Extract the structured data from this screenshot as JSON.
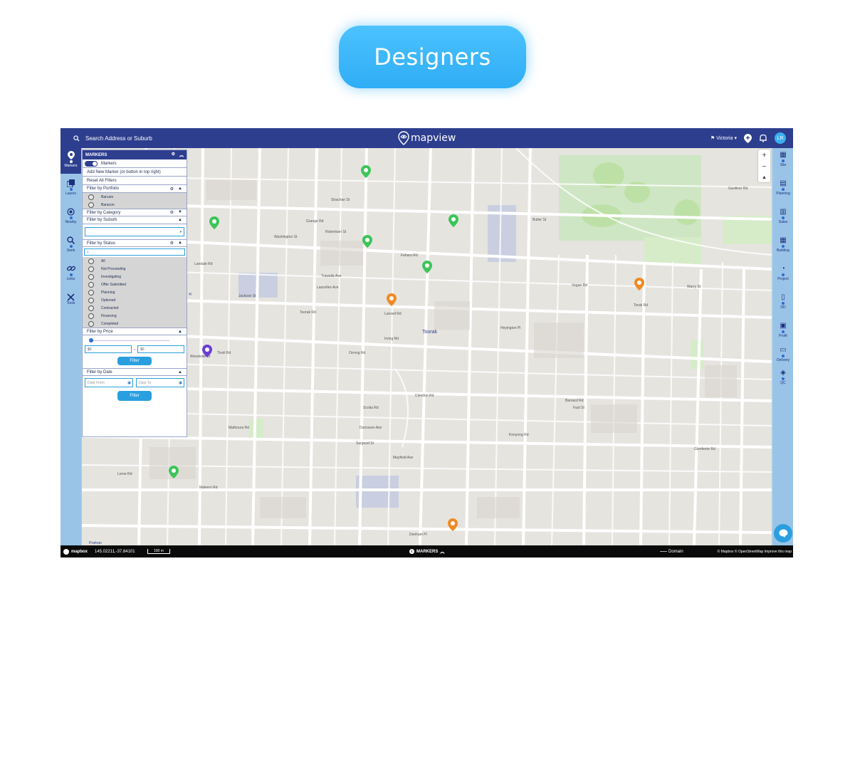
{
  "banner": {
    "label": "Designers"
  },
  "topbar": {
    "search_placeholder": "Search Address or Suburb",
    "logo": "mapview",
    "region": "Victoria",
    "avatar": "LR"
  },
  "left_rail": [
    {
      "label": "Markers",
      "icon": "map-pin-icon"
    },
    {
      "label": "Layers",
      "icon": "layers-icon"
    },
    {
      "label": "Nearby",
      "icon": "target-icon"
    },
    {
      "label": "Seek",
      "icon": "search-icon"
    },
    {
      "label": "Links",
      "icon": "link-icon"
    },
    {
      "label": "Tools",
      "icon": "tools-icon"
    }
  ],
  "right_rail": [
    {
      "label": "Site",
      "icon": "site-icon"
    },
    {
      "label": "Planning",
      "icon": "calendar-icon"
    },
    {
      "label": "Sales",
      "icon": "chart-icon"
    },
    {
      "label": "Building",
      "icon": "building-icon"
    },
    {
      "label": "Project",
      "icon": "project-icon"
    },
    {
      "label": "DD",
      "icon": "document-icon"
    },
    {
      "label": "Profit",
      "icon": "profit-icon"
    },
    {
      "label": "Delivery",
      "icon": "delivery-icon"
    },
    {
      "label": "QC",
      "icon": "qc-icon"
    }
  ],
  "panel": {
    "title": "MARKERS",
    "markers_toggle": "Markers",
    "add_new": "Add New Marker (or button in top right)",
    "reset": "Reset All Filters",
    "portfolio": {
      "label": "Filter by Portfolio",
      "options": [
        "Barcam",
        "Baracon"
      ]
    },
    "category": {
      "label": "Filter by Category"
    },
    "suburb": {
      "label": "Filter by Suburb"
    },
    "status": {
      "label": "Filter by Status",
      "options": [
        "All",
        "Not Proceeding",
        "Investigating",
        "Offer Submitted",
        "Planning",
        "Optioned",
        "Contracted",
        "Financing",
        "Completed"
      ]
    },
    "price": {
      "label": "Filter by Price",
      "min": "$0",
      "max": "$0",
      "separator": "-",
      "button": "Filter"
    },
    "date": {
      "label": "Filter by Date",
      "from_placeholder": "Date From",
      "to_placeholder": "Date To",
      "button": "Filter"
    }
  },
  "map": {
    "streets": [
      "Strachan St",
      "Washington St",
      "Robertson St",
      "Landale Rd",
      "Jackson St",
      "Toorak Rd",
      "Lascelles Ave",
      "Tivoli Rd",
      "Grange Rd",
      "Orrong Rd",
      "Woodside Cr",
      "Malvern Rd",
      "Mathoura Rd",
      "Irving Rd",
      "Kooyong Rd",
      "Toorak",
      "Glenferrie Rd",
      "Warry St",
      "Butler St",
      "Fahara Rd",
      "Clendon Rd",
      "Lansell Rd",
      "Heyington Pl",
      "Trawalla Ave",
      "Scotia Rd",
      "Sargood St",
      "Dunraven Ave",
      "Mayfield Ave",
      "Denham Pl",
      "Lorne Rd",
      "Prahran",
      "Gardiner Rd",
      "Vogue Rd",
      "Fast St",
      "Torak Rd",
      "Barnard Rd"
    ]
  },
  "bottombar": {
    "brand": "mapbox",
    "coords": "145.02211,-37.84101",
    "scale": "100 m",
    "markers_label": "MARKERS",
    "domain": "Domain",
    "attribution": "© Mapbox © OpenStreetMap Improve this map"
  },
  "colors": {
    "nav": "#2d3e8f",
    "accent": "#2a9fe0",
    "green_pin": "#3dc45a",
    "orange_pin": "#f08a24",
    "purple_pin": "#6b3fd0"
  }
}
